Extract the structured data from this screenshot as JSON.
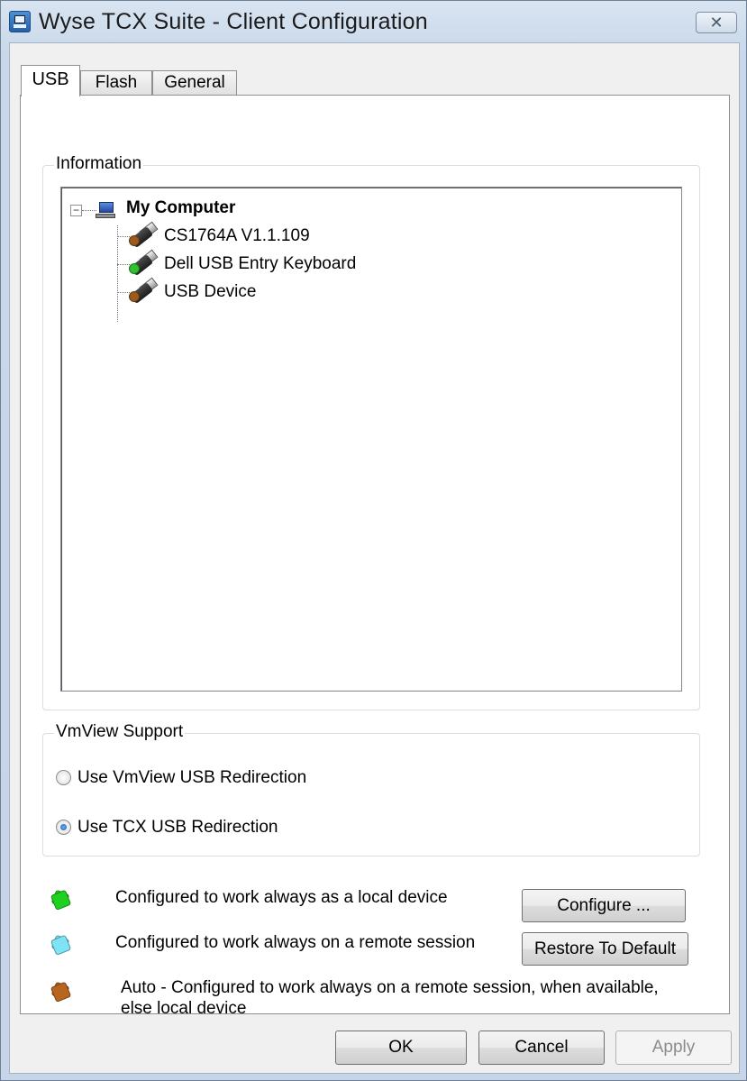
{
  "window": {
    "title": "Wyse TCX Suite - Client Configuration",
    "close_glyph": "✕"
  },
  "tabs": [
    {
      "label": "USB",
      "active": true
    },
    {
      "label": "Flash",
      "active": false
    },
    {
      "label": "General",
      "active": false
    }
  ],
  "information": {
    "group_label": "Information",
    "tree": {
      "root": {
        "label": "My Computer",
        "expander": "−",
        "icon": "computer-icon"
      },
      "children": [
        {
          "label": "CS1764A V1.1.109",
          "status_color": "#9c5a1c"
        },
        {
          "label": "Dell USB Entry Keyboard",
          "status_color": "#2ec22e"
        },
        {
          "label": "USB Device",
          "status_color": "#9c5a1c"
        }
      ]
    }
  },
  "vmview_support": {
    "group_label": "VmView Support",
    "options": [
      {
        "label": "Use VmView USB Redirection",
        "checked": false
      },
      {
        "label": "Use TCX USB Redirection",
        "checked": true
      }
    ]
  },
  "legend": [
    {
      "color": "#1fd11f",
      "text": "Configured to work always as a local device"
    },
    {
      "color": "#7fe3f7",
      "text": "Configured to work always on a remote session"
    },
    {
      "color": "#b8651f",
      "text_line1": "Auto - Configured to work always on a remote session, when available,",
      "text_line2": "else local device"
    }
  ],
  "buttons": {
    "configure": "Configure ...",
    "restore": "Restore To Default",
    "ok": "OK",
    "cancel": "Cancel",
    "apply": "Apply"
  }
}
